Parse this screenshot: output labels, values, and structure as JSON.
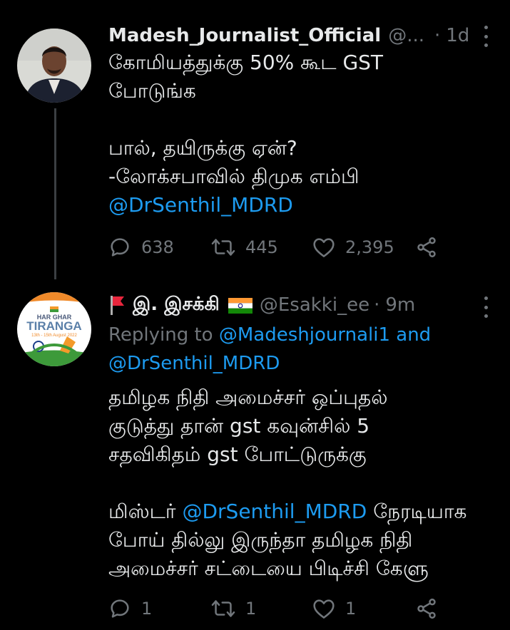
{
  "tweet1": {
    "display_name": "Madesh_Journalist_Official",
    "handle": "@...",
    "time": "1d",
    "lines": [
      "கோமியத்துக்கு 50% கூட GST",
      "போடுங்க",
      "",
      "பால், தயிருக்கு ஏன்?",
      "-லோக்சபாவில் திமுக எம்பி"
    ],
    "mention": "@DrSenthil_MDRD",
    "replies": "638",
    "retweets": "445",
    "likes": "2,395"
  },
  "tweet2": {
    "display_name": "இ. இசக்கி",
    "handle": "@Esakki_ee",
    "time": "9m",
    "replying_prefix": "Replying to",
    "replying_user1": "@Madeshjournali1",
    "replying_and": "and",
    "replying_user2": "@DrSenthil_MDRD",
    "para1": [
      "தமிழக நிதி அமைச்சர் ஒப்புதல்",
      "குடுத்து தான் gst கவுன்சில் 5",
      "சதவிகிதம் gst போட்டுருக்கு"
    ],
    "para2_start": "மிஸ்டர்",
    "para2_mention": "@DrSenthil_MDRD",
    "para2_after": "நேரடியாக",
    "para2_lines": [
      "போய் தில்லு இருந்தா தமிழக நிதி",
      "அமைச்சர் சட்டையை பிடிச்சி கேளு"
    ],
    "replies": "1",
    "retweets": "1",
    "likes": "1",
    "avatar_text": {
      "line1": "HAR GHAR",
      "line2": "TIRANGA",
      "line3": "13th - 15th August 2022"
    }
  },
  "icons": [
    "reply-icon",
    "retweet-icon",
    "like-icon",
    "share-icon",
    "more-icon",
    "red-flag-icon",
    "india-flag-icon"
  ],
  "colors": {
    "background": "#000000",
    "text": "#e7e9ea",
    "secondary": "#71767b",
    "link": "#1d9bf0"
  }
}
